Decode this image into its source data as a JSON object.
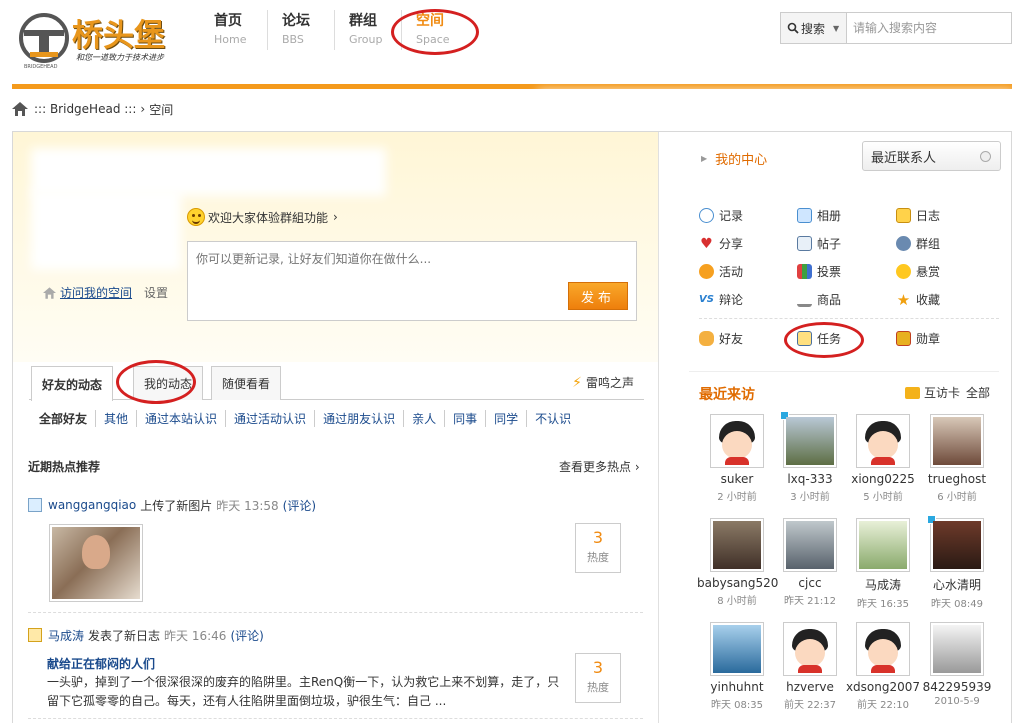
{
  "logo": {
    "brand": "桥头堡",
    "slogan": "和您一道致力于技术进步",
    "tiny": "BRIDGEHEAD"
  },
  "nav": [
    {
      "cn": "首页",
      "en": "Home"
    },
    {
      "cn": "论坛",
      "en": "BBS"
    },
    {
      "cn": "群组",
      "en": "Group"
    },
    {
      "cn": "空间",
      "en": "Space"
    }
  ],
  "search": {
    "type_label": "搜索",
    "placeholder": "请输入搜索内容"
  },
  "breadcrumb": {
    "site": "::: BridgeHead :::",
    "sep": "›",
    "current": "空间"
  },
  "profile": {
    "welcome": "欢迎大家体验群組功能",
    "welcome_arrow": "›",
    "status_placeholder": "你可以更新记录, 让好友们知道你在做什么...",
    "publish_label": "发布",
    "visit_link": "访问我的空间",
    "settings_label": "设置"
  },
  "tabs": [
    {
      "label": "好友的动态"
    },
    {
      "label": "我的动态"
    },
    {
      "label": "随便看看"
    }
  ],
  "thunder_label": "雷鸣之声",
  "filters": [
    "全部好友",
    "其他",
    "通过本站认识",
    "通过活动认识",
    "通过朋友认识",
    "亲人",
    "同事",
    "同学",
    "不认识"
  ],
  "hot": {
    "title": "近期热点推荐",
    "more": "查看更多热点 ›"
  },
  "feed": [
    {
      "user": "wanggangqiao",
      "action": "上传了新图片",
      "time": "昨天 13:58",
      "comment": "(评论)",
      "heat": "3",
      "heat_label": "热度"
    },
    {
      "user": "马成涛",
      "action": "发表了新日志",
      "time": "昨天 16:46",
      "comment": "(评论)",
      "heat": "3",
      "heat_label": "热度",
      "blog_title": "献给正在郁闷的人们",
      "blog_body": "一头驴，掉到了一个很深很深的废弃的陷阱里。主RenQ衡一下，认为救它上来不划算，走了，只留下它孤零零的自己。每天，还有人往陷阱里面倒垃圾，驴很生气：自己 ..."
    }
  ],
  "right": {
    "my_center": "我的中心",
    "recent_contacts": "最近联系人",
    "apps": [
      {
        "label": "记录",
        "icon": "speech-bubble-icon"
      },
      {
        "label": "相册",
        "icon": "photo-icon"
      },
      {
        "label": "日志",
        "icon": "notebook-icon"
      },
      {
        "label": "分享",
        "icon": "heart-icon"
      },
      {
        "label": "帖子",
        "icon": "post-icon"
      },
      {
        "label": "群组",
        "icon": "group-icon"
      },
      {
        "label": "活动",
        "icon": "activity-icon"
      },
      {
        "label": "投票",
        "icon": "poll-icon"
      },
      {
        "label": "悬赏",
        "icon": "bounty-icon"
      },
      {
        "label": "辩论",
        "icon": "versus-icon"
      },
      {
        "label": "商品",
        "icon": "cart-icon"
      },
      {
        "label": "收藏",
        "icon": "star-icon"
      },
      {
        "label": "好友",
        "icon": "handshake-icon"
      },
      {
        "label": "任务",
        "icon": "task-icon"
      },
      {
        "label": "勋章",
        "icon": "medal-icon"
      }
    ],
    "visitors_title": "最近来访",
    "visit_card": "互访卡",
    "all_label": "全部",
    "visitors": [
      {
        "name": "suker",
        "time": "2 小时前"
      },
      {
        "name": "lxq-333",
        "time": "3 小时前"
      },
      {
        "name": "xiong0225",
        "time": "5 小时前"
      },
      {
        "name": "trueghost",
        "time": "6 小时前"
      },
      {
        "name": "babysang520",
        "time": "8 小时前"
      },
      {
        "name": "cjcc",
        "time": "昨天 21:12"
      },
      {
        "name": "马成涛",
        "time": "昨天 16:35"
      },
      {
        "name": "心水清明",
        "time": "昨天 08:49"
      },
      {
        "name": "yinhuhnt",
        "time": "昨天 08:35"
      },
      {
        "name": "hzverve",
        "time": "前天 22:37"
      },
      {
        "name": "xdsong2007",
        "time": "前天 22:10"
      },
      {
        "name": "842295939",
        "time": "2010-5-9"
      }
    ]
  },
  "colors": {
    "accent": "#f49a1c",
    "link": "#1a4a8c",
    "highlight": "#e06b00",
    "annotation": "#d42020"
  }
}
